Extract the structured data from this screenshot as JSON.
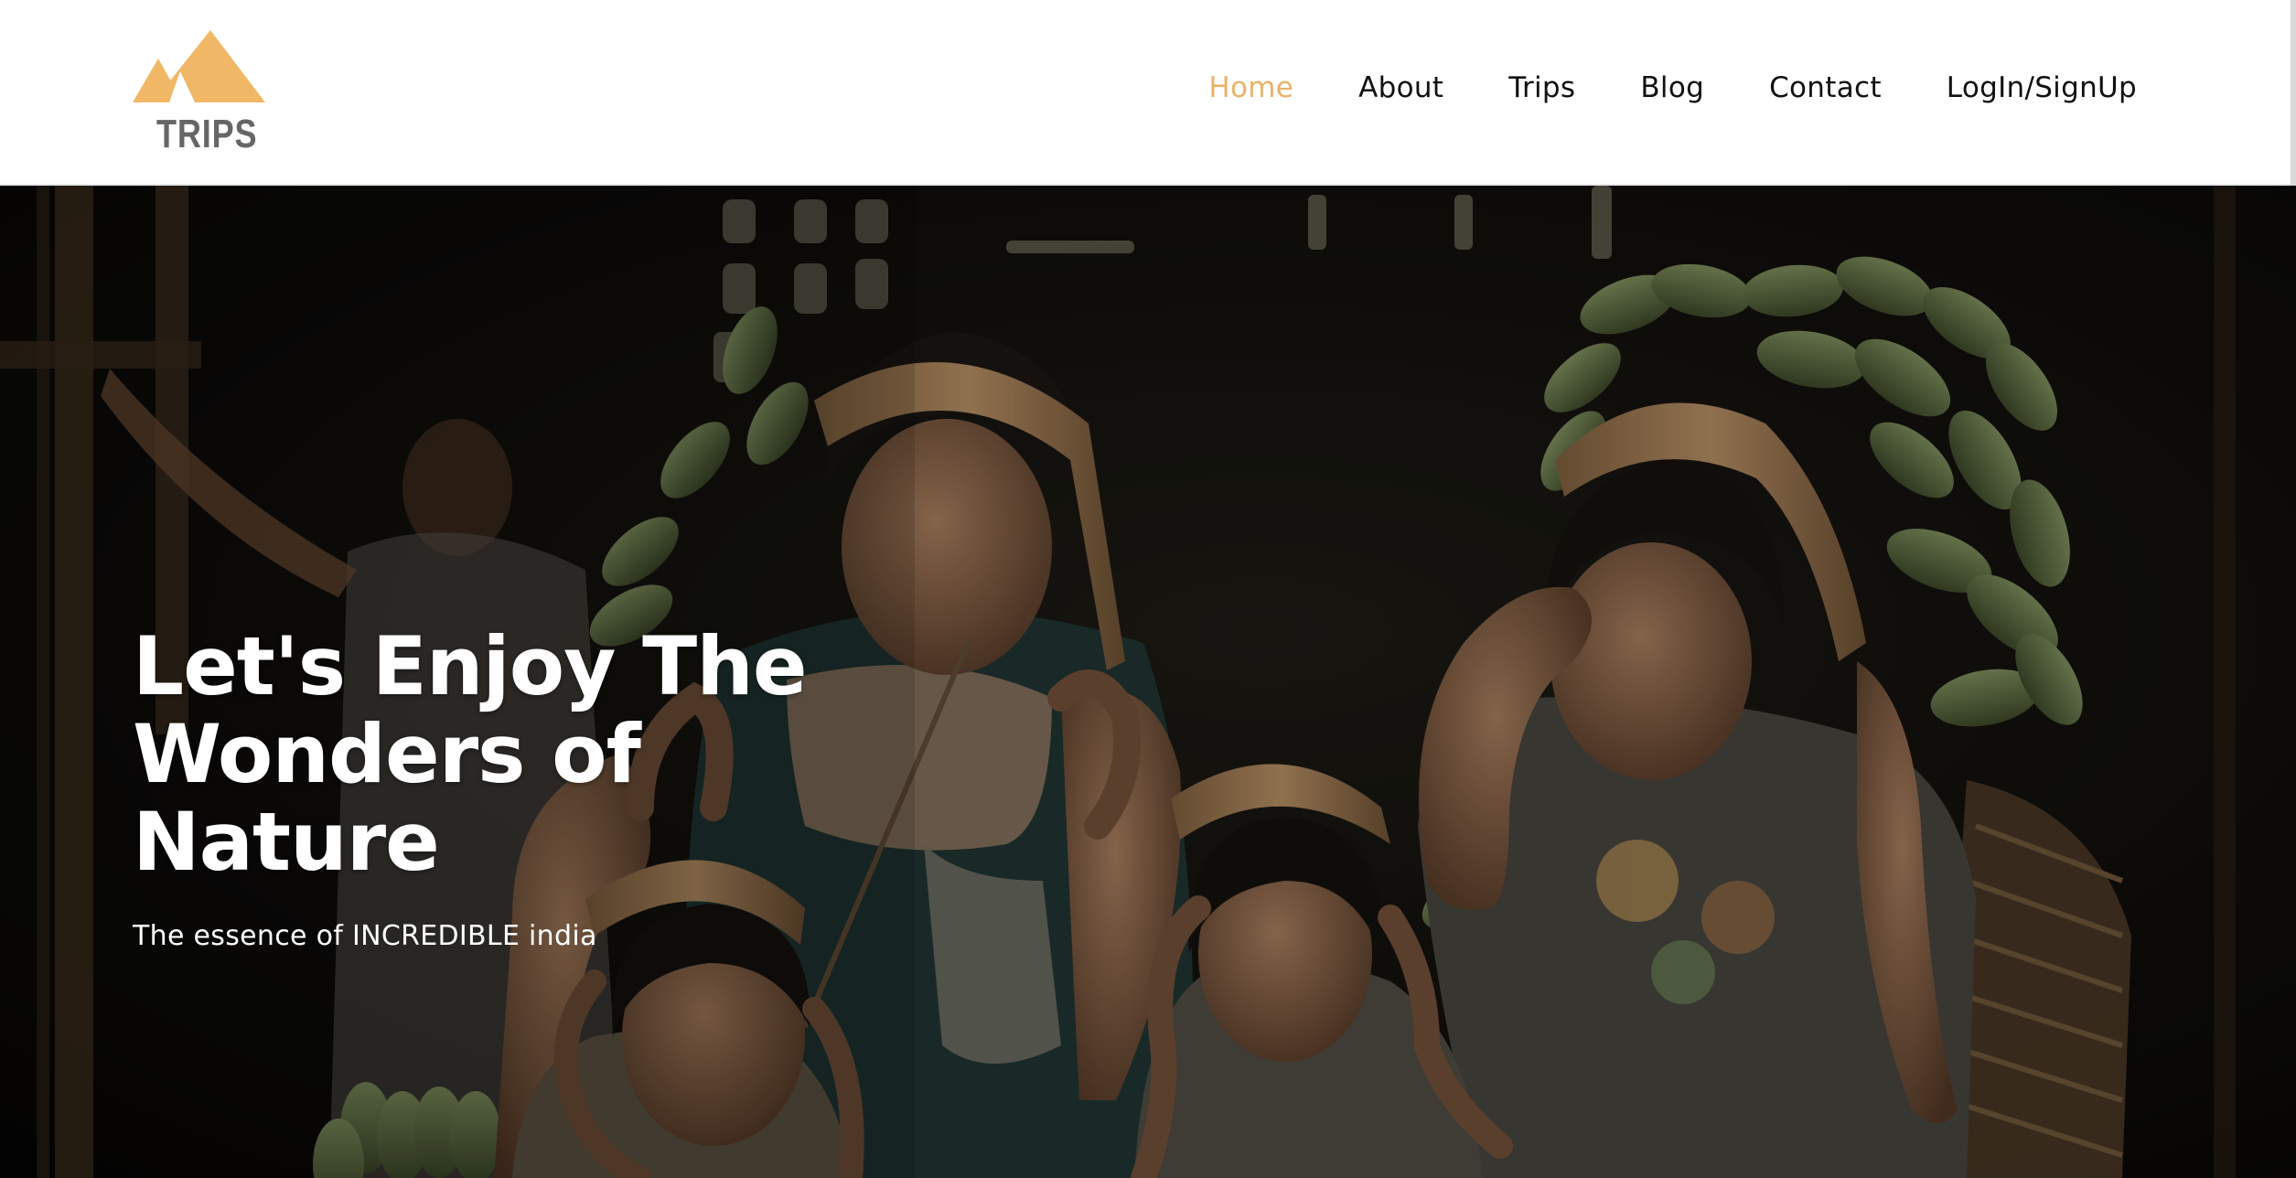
{
  "header": {
    "logo": {
      "text": "TRIPS",
      "icon": "mountain-icon",
      "color": "#f0b866"
    },
    "nav": {
      "items": [
        {
          "label": "Home",
          "active": true
        },
        {
          "label": "About",
          "active": false
        },
        {
          "label": "Trips",
          "active": false
        },
        {
          "label": "Blog",
          "active": false
        },
        {
          "label": "Contact",
          "active": false
        },
        {
          "label": "LogIn/SignUp",
          "active": false
        }
      ],
      "active_color": "#e8b369"
    }
  },
  "hero": {
    "title": "Let's Enjoy The Wonders of Nature",
    "subtitle": "The essence of INCREDIBLE india"
  }
}
